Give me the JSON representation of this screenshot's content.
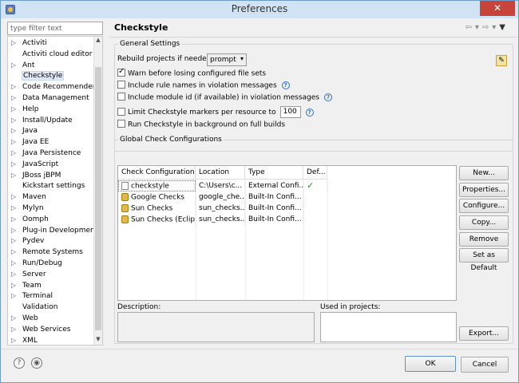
{
  "window": {
    "title": "Preferences",
    "close_label": "✕"
  },
  "filter": {
    "placeholder": "type filter text"
  },
  "tree": {
    "items": [
      {
        "label": "Activiti",
        "arrow": "▷"
      },
      {
        "label": "Activiti cloud editor",
        "arrow": ""
      },
      {
        "label": "Ant",
        "arrow": "▷"
      },
      {
        "label": "Checkstyle",
        "arrow": "",
        "selected": true
      },
      {
        "label": "Code Recommenders",
        "arrow": "▷"
      },
      {
        "label": "Data Management",
        "arrow": "▷"
      },
      {
        "label": "Help",
        "arrow": "▷"
      },
      {
        "label": "Install/Update",
        "arrow": "▷"
      },
      {
        "label": "Java",
        "arrow": "▷"
      },
      {
        "label": "Java EE",
        "arrow": "▷"
      },
      {
        "label": "Java Persistence",
        "arrow": "▷"
      },
      {
        "label": "JavaScript",
        "arrow": "▷"
      },
      {
        "label": "JBoss jBPM",
        "arrow": "▷"
      },
      {
        "label": "Kickstart settings",
        "arrow": ""
      },
      {
        "label": "Maven",
        "arrow": "▷"
      },
      {
        "label": "Mylyn",
        "arrow": "▷"
      },
      {
        "label": "Oomph",
        "arrow": "▷"
      },
      {
        "label": "Plug-in Development",
        "arrow": "▷"
      },
      {
        "label": "Pydev",
        "arrow": "▷"
      },
      {
        "label": "Remote Systems",
        "arrow": "▷"
      },
      {
        "label": "Run/Debug",
        "arrow": "▷"
      },
      {
        "label": "Server",
        "arrow": "▷"
      },
      {
        "label": "Team",
        "arrow": "▷"
      },
      {
        "label": "Terminal",
        "arrow": "▷"
      },
      {
        "label": "Validation",
        "arrow": ""
      },
      {
        "label": "Web",
        "arrow": "▷"
      },
      {
        "label": "Web Services",
        "arrow": "▷"
      },
      {
        "label": "XML",
        "arrow": "▷"
      }
    ]
  },
  "page": {
    "title": "Checkstyle"
  },
  "general": {
    "legend": "General Settings",
    "rebuild_label": "Rebuild projects if needed:",
    "rebuild_value": "prompt",
    "warn_label": "Warn before losing configured file sets",
    "warn_checked": true,
    "rule_names_label": "Include rule names in violation messages",
    "module_id_label": "Include module id (if available) in violation messages",
    "limit_label": "Limit Checkstyle markers per resource to",
    "limit_value": "100",
    "background_label": "Run Checkstyle in background on full builds"
  },
  "global": {
    "legend": "Global Check Configurations",
    "columns": [
      "Check Configuration",
      "Location",
      "Type",
      "Def..."
    ],
    "rows": [
      {
        "name": "checkstyle",
        "location": "C:\\Users\\c...",
        "type": "External Confi...",
        "default": "✓",
        "icon": "file-icon"
      },
      {
        "name": "Google Checks",
        "location": "google_che...",
        "type": "Built-In Confi...",
        "default": "",
        "icon": "lock-icon"
      },
      {
        "name": "Sun Checks",
        "location": "sun_checks....",
        "type": "Built-In Confi...",
        "default": "",
        "icon": "lock-icon"
      },
      {
        "name": "Sun Checks (Eclip...",
        "location": "sun_checks....",
        "type": "Built-In Confi...",
        "default": "",
        "icon": "lock-icon"
      }
    ],
    "buttons": {
      "new": "New...",
      "properties": "Properties...",
      "configure": "Configure...",
      "copy": "Copy...",
      "remove": "Remove",
      "set_default": "Set as Default",
      "export": "Export..."
    },
    "description_label": "Description:",
    "used_in_label": "Used in projects:"
  },
  "footer": {
    "ok": "OK",
    "cancel": "Cancel"
  }
}
